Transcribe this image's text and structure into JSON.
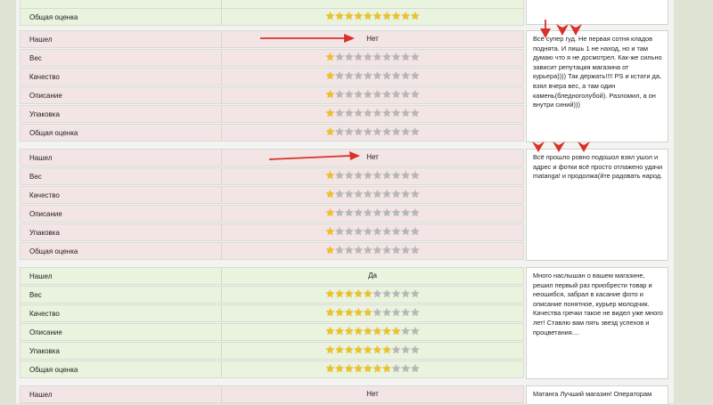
{
  "labels": {
    "found": "Нашел",
    "weight": "Вес",
    "quality": "Качество",
    "description": "Описание",
    "packing": "Упаковка",
    "overall": "Общая оценка"
  },
  "star_max": 10,
  "colors": {
    "bad_row": "#f3e5e5",
    "good_row": "#e9f3de",
    "star_on": "#f4c11a",
    "star_off": "#b7b7b7",
    "arrow": "#d8322a"
  },
  "top_partial": {
    "overall_stars": 10
  },
  "reviews": [
    {
      "found_value": "Нет",
      "weight_stars": 1,
      "quality_stars": 1,
      "description_stars": 1,
      "packing_stars": 1,
      "overall_stars": 1,
      "comment": "Всё супер гуд. Не первая сотня кладов поднята. И лишь 1 не наход, но и там думаю что я не досмотрел. Как-же сильно зависит репутация магазина от курьера)))) Так держать!!!! PS и кстати да, взял вчера вес, а там один камень(бледноголубой). Разломил, а он внутри синий)))"
    },
    {
      "found_value": "Нет",
      "weight_stars": 1,
      "quality_stars": 1,
      "description_stars": 1,
      "packing_stars": 1,
      "overall_stars": 1,
      "comment": "Всё прошло ровно подошол взял ушол и адрес и фотки всё просто отлажено удачи matanga! и продолжа(йте радовать народ."
    },
    {
      "found_value": "Да",
      "weight_stars": 5,
      "quality_stars": 5,
      "description_stars": 8,
      "packing_stars": 7,
      "overall_stars": 7,
      "comment": "Много наслышан о вашем магазине, решил первый раз приобрести товар и неошибся, забрал в касание фото и описание понятное, курьер молодчик. Качества гречки такое не видел уже много лет! Ставлю вам пять звезд успехов и процветания...."
    },
    {
      "found_value": "Нет",
      "comment": "Матанга Лучший магазин! Операторам"
    }
  ]
}
